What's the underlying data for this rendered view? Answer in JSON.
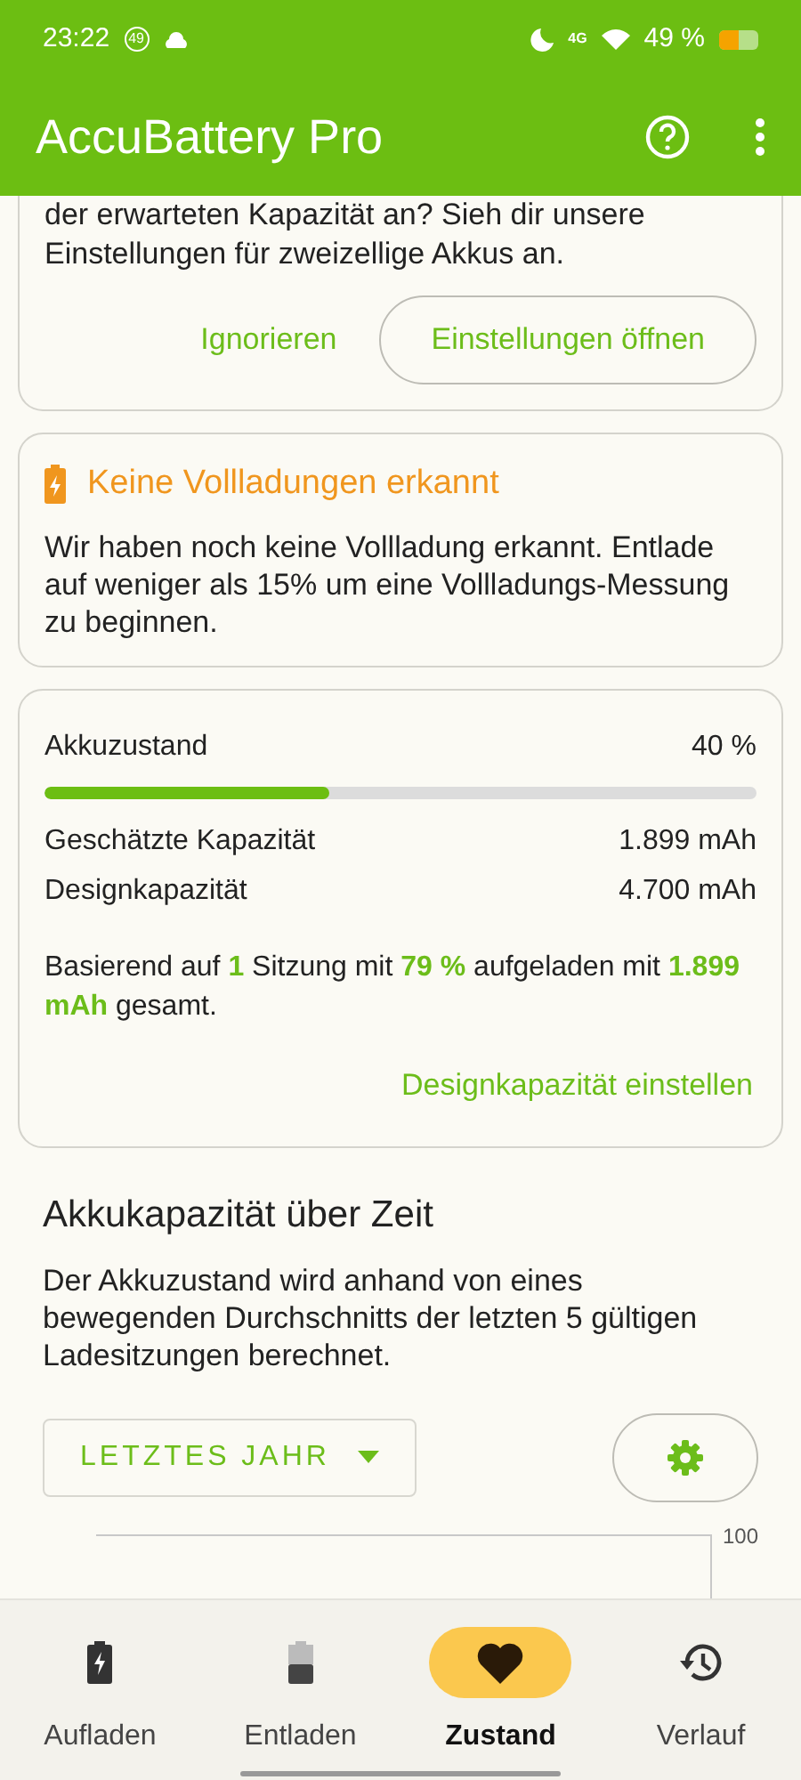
{
  "status_bar": {
    "time": "23:22",
    "badge": "49",
    "network": "4G",
    "battery": "49 %"
  },
  "app_bar": {
    "title": "AccuBattery Pro"
  },
  "notice_card": {
    "text": "der erwarteten Kapazität an? Sieh dir unsere Einstellungen für zweizellige Akkus an.",
    "buttons": [
      "Ignorieren",
      "Einstellungen öffnen"
    ]
  },
  "warning_card": {
    "title": "Keine Vollladungen erkannt",
    "text": "Wir haben noch keine Vollladung erkannt. Entlade auf weniger als 15% um eine Vollladungs-Messung zu beginnen."
  },
  "health_card": {
    "label": "Akkuzustand",
    "value": "40 %",
    "level": 0.4,
    "rows": [
      {
        "label": "Geschätzte Kapazität",
        "value": "1.899 mAh"
      },
      {
        "label": "Designkapazität",
        "value": "4.700 mAh"
      }
    ],
    "summary": "Basierend auf **1** Sitzung mit **79 %** aufgeladen mit **1.899 mAh** gesamt.",
    "action": "Designkapazität einstellen"
  },
  "capacity_section": {
    "title": "Akkukapazität über Zeit",
    "text": "Der Akkuzustand wird anhand von eines bewegenden Durchschnitts der letzten 5 gültigen Ladesitzungen berechnet.",
    "range": "LETZTES JAHR",
    "y_tick": "100"
  },
  "bottom_nav": [
    {
      "label": "Aufladen",
      "kind": "charge",
      "selected": false
    },
    {
      "label": "Entladen",
      "kind": "discharge",
      "selected": false
    },
    {
      "label": "Zustand",
      "kind": "health",
      "selected": true
    },
    {
      "label": "Verlauf",
      "kind": "history",
      "selected": false
    }
  ]
}
